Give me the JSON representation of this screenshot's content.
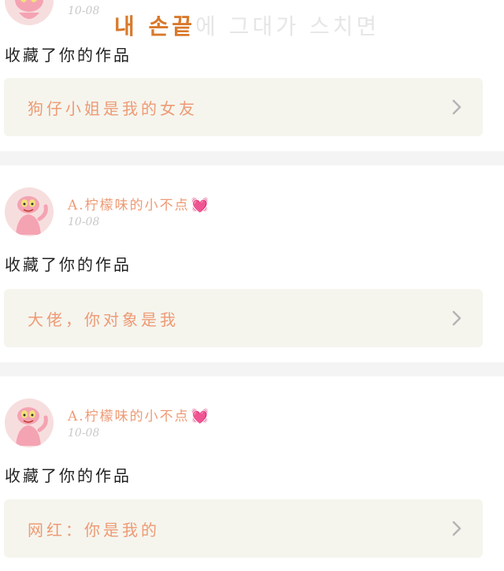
{
  "overlay_caption": {
    "highlight": "내 손끝",
    "rest": "에 그대가 스치면"
  },
  "posts": [
    {
      "date": "10-08",
      "action": "收藏了你的作品",
      "work_title": "狗仔小姐是我的女友"
    },
    {
      "username": "A.柠檬味的小不点",
      "date": "10-08",
      "action": "收藏了你的作品",
      "work_title": "大佬，你对象是我"
    },
    {
      "username": "A.柠檬味的小不点",
      "date": "10-08",
      "action": "收藏了你的作品",
      "work_title": "网红：你是我的"
    }
  ],
  "icons": {
    "heart": "heart-icon",
    "chevron": "chevron-right-icon",
    "avatar": "pink-panther-avatar"
  },
  "colors": {
    "accent": "#ee9a74",
    "card_bg": "#f5f5ee",
    "heart": "#ea3e88"
  }
}
